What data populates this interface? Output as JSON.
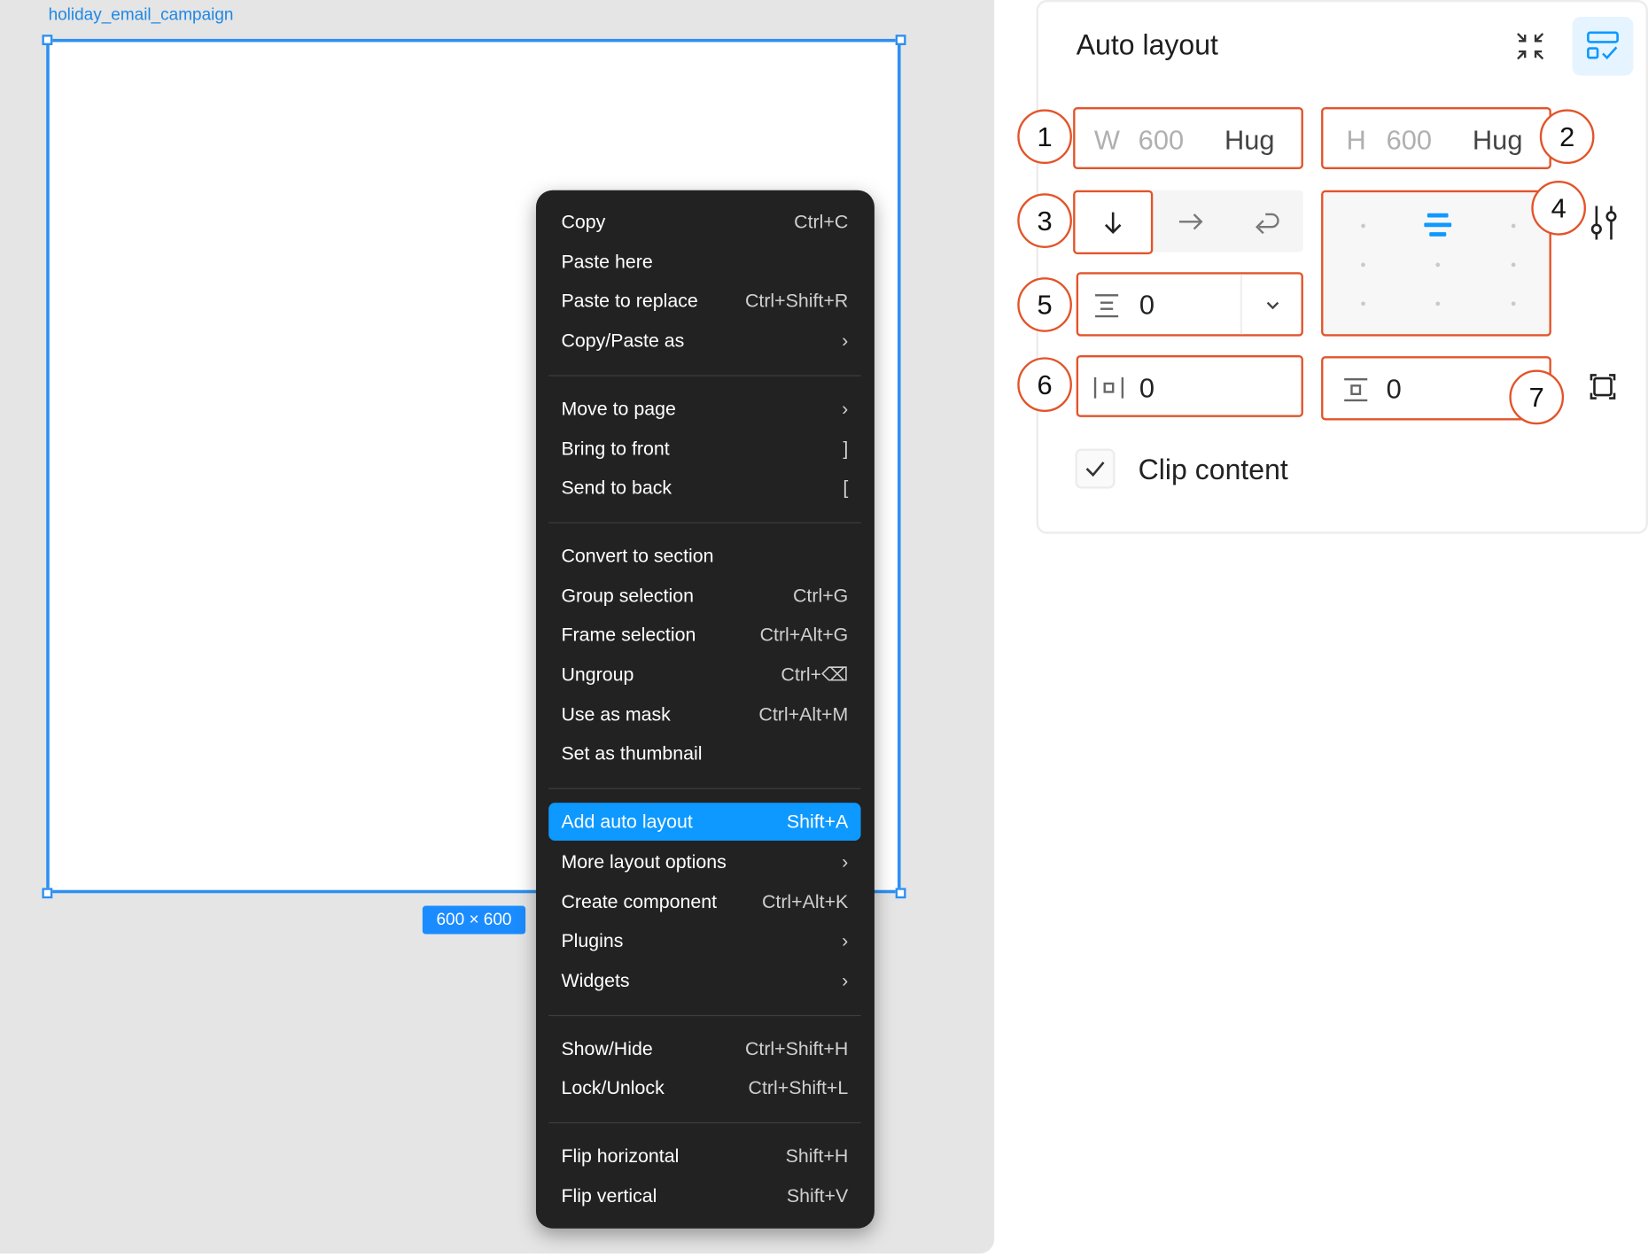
{
  "canvas": {
    "frame_name": "holiday_email_campaign",
    "size_badge": "600 × 600"
  },
  "context_menu": {
    "groups": [
      [
        {
          "label": "Copy",
          "shortcut": "Ctrl+C"
        },
        {
          "label": "Paste here",
          "shortcut": ""
        },
        {
          "label": "Paste to replace",
          "shortcut": "Ctrl+Shift+R"
        },
        {
          "label": "Copy/Paste as",
          "shortcut": "›"
        }
      ],
      [
        {
          "label": "Move to page",
          "shortcut": "›"
        },
        {
          "label": "Bring to front",
          "shortcut": "]"
        },
        {
          "label": "Send to back",
          "shortcut": "["
        }
      ],
      [
        {
          "label": "Convert to section",
          "shortcut": ""
        },
        {
          "label": "Group selection",
          "shortcut": "Ctrl+G"
        },
        {
          "label": "Frame selection",
          "shortcut": "Ctrl+Alt+G"
        },
        {
          "label": "Ungroup",
          "shortcut": "Ctrl+⌫"
        },
        {
          "label": "Use as mask",
          "shortcut": "Ctrl+Alt+M"
        },
        {
          "label": "Set as thumbnail",
          "shortcut": ""
        }
      ],
      [
        {
          "label": "Add auto layout",
          "shortcut": "Shift+A",
          "active": true
        },
        {
          "label": "More layout options",
          "shortcut": "›"
        },
        {
          "label": "Create component",
          "shortcut": "Ctrl+Alt+K"
        },
        {
          "label": "Plugins",
          "shortcut": "›"
        },
        {
          "label": "Widgets",
          "shortcut": "›"
        }
      ],
      [
        {
          "label": "Show/Hide",
          "shortcut": "Ctrl+Shift+H"
        },
        {
          "label": "Lock/Unlock",
          "shortcut": "Ctrl+Shift+L"
        }
      ],
      [
        {
          "label": "Flip horizontal",
          "shortcut": "Shift+H"
        },
        {
          "label": "Flip vertical",
          "shortcut": "Shift+V"
        }
      ]
    ]
  },
  "panel": {
    "title": "Auto layout",
    "width": {
      "prefix": "W",
      "value": "600",
      "mode": "Hug"
    },
    "height": {
      "prefix": "H",
      "value": "600",
      "mode": "Hug"
    },
    "gap": {
      "value": "0"
    },
    "padding_horizontal": {
      "value": "0"
    },
    "padding_vertical": {
      "value": "0"
    },
    "clip_content": {
      "label": "Clip content",
      "checked": true
    },
    "callouts": [
      "1",
      "2",
      "3",
      "4",
      "5",
      "6",
      "7"
    ],
    "accent_color": "#0d99ff",
    "highlight_color": "#e2542a"
  }
}
